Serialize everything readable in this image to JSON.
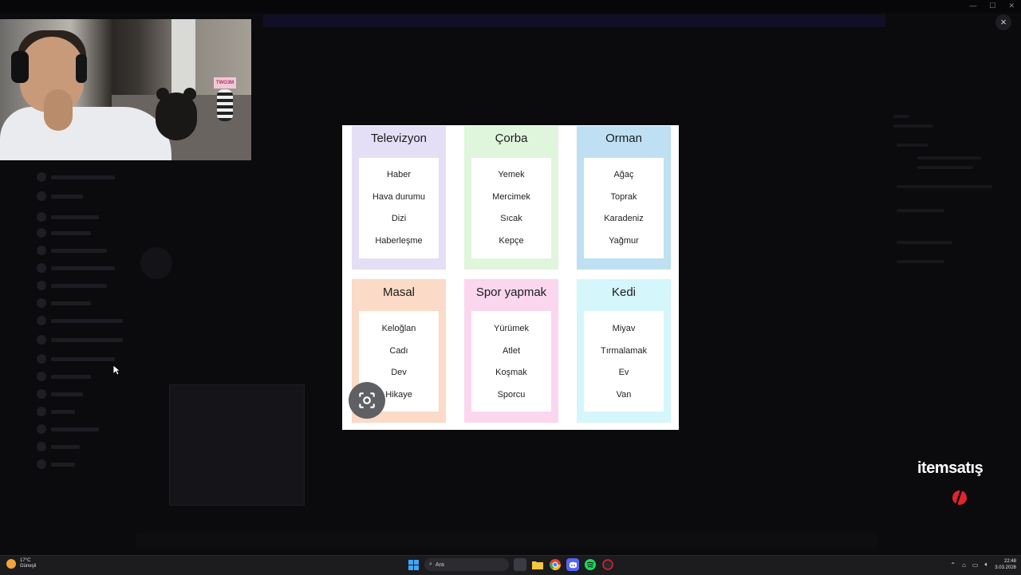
{
  "overlay": {
    "close_label": "×"
  },
  "cards": [
    {
      "title": "Televizyon",
      "color": "#e4dff5",
      "words": [
        "Haber",
        "Hava durumu",
        "Dizi",
        "Haberleşme"
      ]
    },
    {
      "title": "Çorba",
      "color": "#dff5dc",
      "words": [
        "Yemek",
        "Mercimek",
        "Sıcak",
        "Kepçe"
      ]
    },
    {
      "title": "Orman",
      "color": "#bfe0f2",
      "words": [
        "Ağaç",
        "Toprak",
        "Karadeniz",
        "Yağmur"
      ]
    },
    {
      "title": "Masal",
      "color": "#fbdac7",
      "words": [
        "Keloğlan",
        "Cadı",
        "Dev",
        "Hikaye"
      ]
    },
    {
      "title": "Spor yapmak",
      "color": "#fad7ee",
      "words": [
        "Yürümek",
        "Atlet",
        "Koşmak",
        "Sporcu"
      ]
    },
    {
      "title": "Kedi",
      "color": "#d5f6fb",
      "words": [
        "Miyav",
        "Tırmalamak",
        "Ev",
        "Van"
      ]
    }
  ],
  "webcam": {
    "sign_text": "TWO3M"
  },
  "brand": {
    "name": "itemsatış"
  },
  "taskbar": {
    "weather_temp": "17°C",
    "weather_desc": "Güneşli",
    "search_placeholder": "Ara",
    "time": "22:48",
    "date": "3.03.2026"
  },
  "colors": {
    "accent": "#5865f2",
    "brand_red": "#e0242b"
  }
}
